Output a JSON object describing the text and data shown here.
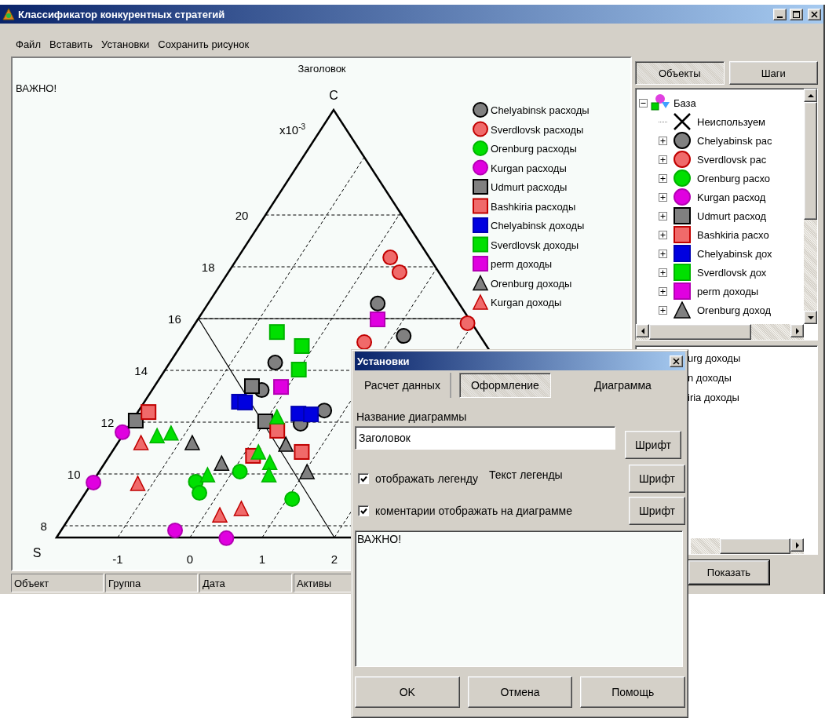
{
  "window": {
    "title": "Классификатор конкурентных стратегий"
  },
  "menu": [
    {
      "label": "Файл"
    },
    {
      "label": "Вставить"
    },
    {
      "label": "Установки"
    },
    {
      "label": "Сохранить рисунок"
    }
  ],
  "chart": {
    "title": "Заголовок",
    "comment": "ВАЖНО!",
    "apex_label": "C",
    "corner_label": "S",
    "scale_label": "x10$^{-3}$",
    "left_ticks": [
      "8",
      "10",
      "12",
      "14",
      "16",
      "18",
      "20"
    ],
    "bottom_ticks": [
      "-1",
      "0",
      "1",
      "2"
    ],
    "legend": [
      {
        "label": "Chelyabinsk расходы",
        "kind": "circle",
        "color": "#808080"
      },
      {
        "label": "Sverdlovsk расходы",
        "kind": "circle",
        "color": "#f06a6a"
      },
      {
        "label": "Orenburg расходы",
        "kind": "circle",
        "color": "#00e000"
      },
      {
        "label": "Kurgan расходы",
        "kind": "circle",
        "color": "#e000e0"
      },
      {
        "label": "Udmurt расходы",
        "kind": "square",
        "color": "#808080"
      },
      {
        "label": "Bashkiria расходы",
        "kind": "square",
        "color": "#f06a6a"
      },
      {
        "label": "Chelyabinsk доходы",
        "kind": "square",
        "color": "#0000e0"
      },
      {
        "label": "Sverdlovsk доходы",
        "kind": "square",
        "color": "#00e000"
      },
      {
        "label": "perm доходы",
        "kind": "square",
        "color": "#e000e0"
      },
      {
        "label": "Orenburg доходы",
        "kind": "triangle",
        "color": "#808080"
      },
      {
        "label": "Kurgan доходы",
        "kind": "triangle",
        "color": "#f06a6a"
      }
    ]
  },
  "side_panel": {
    "tabs": [
      {
        "label": "Объекты",
        "selected": true
      },
      {
        "label": "Шаги",
        "selected": false
      }
    ],
    "tree": {
      "label": "База",
      "expanded": true,
      "children": [
        {
          "label": "Неиспользуем",
          "kind": "cross"
        },
        {
          "label": "Chelyabinsk рас",
          "kind": "circle",
          "color": "#808080",
          "expanded": false
        },
        {
          "label": "Sverdlovsk рас",
          "kind": "circle",
          "color": "#f06a6a",
          "expanded": false
        },
        {
          "label": "Orenburg расхо",
          "kind": "circle",
          "color": "#00e000",
          "expanded": false
        },
        {
          "label": "Kurgan расход",
          "kind": "circle",
          "color": "#e000e0",
          "expanded": false
        },
        {
          "label": "Udmurt расход",
          "kind": "square",
          "color": "#808080",
          "expanded": false
        },
        {
          "label": "Bashkiria расхо",
          "kind": "square",
          "color": "#f06a6a",
          "expanded": false
        },
        {
          "label": "Chelyabinsk дох",
          "kind": "square",
          "color": "#0000e0",
          "expanded": false
        },
        {
          "label": "Sverdlovsk дох",
          "kind": "square",
          "color": "#00e000",
          "expanded": false
        },
        {
          "label": "perm доходы",
          "kind": "square",
          "color": "#e000e0",
          "expanded": false
        },
        {
          "label": "Orenburg доход",
          "kind": "triangle",
          "color": "#808080",
          "expanded": false
        }
      ]
    },
    "list": [
      "urg доходы",
      "n доходы",
      "iria доходы"
    ],
    "show_button": "Показать"
  },
  "status_bar": [
    "Объект",
    "Группа",
    "Дата",
    "Активы"
  ],
  "dialog": {
    "title": "Установки",
    "tabs": [
      {
        "label": "Расчет данных",
        "selected": false
      },
      {
        "label": "Оформление",
        "selected": true
      },
      {
        "label": "Диаграмма",
        "selected": false
      }
    ],
    "title_label": "Название диаграммы",
    "title_value": "Заголовок",
    "font_button": "Шрифт",
    "legend_checkbox": {
      "label": "отображать легенду",
      "checked": true
    },
    "legend_text_label": "Текст легенды",
    "legend_font_button": "Шрифт",
    "comment_checkbox": {
      "label": "коментарии отображать на диаграмме",
      "checked": true
    },
    "comment_font_button": "Шрифт",
    "comment_text": "ВАЖНО!",
    "buttons": [
      "OK",
      "Отмена",
      "Помощь"
    ]
  }
}
